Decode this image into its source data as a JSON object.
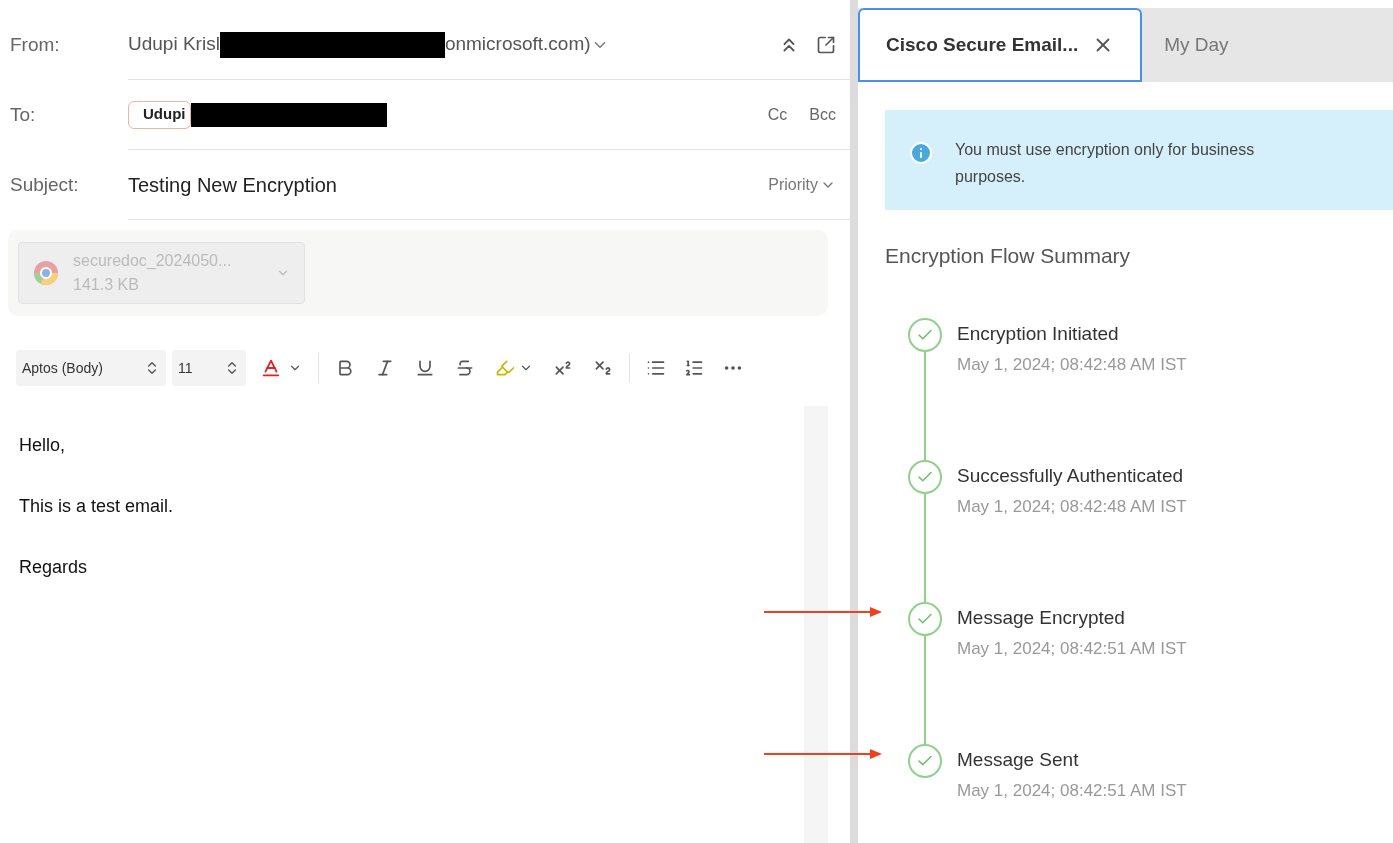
{
  "compose": {
    "from": {
      "label": "From:",
      "value_start": "Udupi Krisl",
      "value_end": "onmicrosoft.com)",
      "redacted": true
    },
    "to": {
      "label": "To:",
      "recipient": "Udupi",
      "redacted": true,
      "cc": "Cc",
      "bcc": "Bcc"
    },
    "subject": {
      "label": "Subject:",
      "value": "Testing New Encryption",
      "priority": "Priority"
    },
    "attachment": {
      "name": "securedoc_2024050...",
      "size": "141.3 KB"
    },
    "toolbar": {
      "font": "Aptos (Body)",
      "size": "11"
    },
    "body": [
      "Hello,",
      "This is a test email.",
      "Regards"
    ]
  },
  "panel": {
    "tabs": [
      {
        "label": "Cisco Secure Email...",
        "selected": true,
        "closable": true
      },
      {
        "label": "My Day",
        "selected": false,
        "closable": false
      }
    ],
    "notice": "You must use encryption only for business purposes.",
    "heading": "Encryption Flow Summary",
    "steps": [
      {
        "title": "Encryption Initiated",
        "time": "May 1, 2024; 08:42:48 AM IST",
        "done": true,
        "highlighted": false
      },
      {
        "title": "Successfully Authenticated",
        "time": "May 1, 2024; 08:42:48 AM IST",
        "done": true,
        "highlighted": false
      },
      {
        "title": "Message Encrypted",
        "time": "May 1, 2024; 08:42:51 AM IST",
        "done": true,
        "highlighted": true
      },
      {
        "title": "Message Sent",
        "time": "May 1, 2024; 08:42:51 AM IST",
        "done": true,
        "highlighted": true
      }
    ]
  }
}
